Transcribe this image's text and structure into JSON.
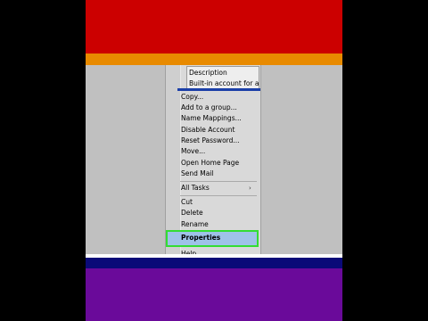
{
  "colors": {
    "top_band": "#cc0000",
    "accent_band": "#e88a00",
    "bottom_band": "#6a0a9a",
    "divider_band": "#0a0a78",
    "highlight_outline": "#33dd33",
    "selection": "#9fc2e8"
  },
  "top_list": {
    "header": "Description",
    "row": "Built-in account for ad..."
  },
  "menu": {
    "items_group1": [
      "Copy...",
      "Add to a group...",
      "Name Mappings...",
      "Disable Account",
      "Reset Password...",
      "Move...",
      "Open Home Page",
      "Send Mail"
    ],
    "all_tasks": "All Tasks",
    "submenu_arrow": "›",
    "items_group3": [
      "Cut",
      "Delete",
      "Rename"
    ],
    "properties": "Properties",
    "partial": "Help"
  }
}
